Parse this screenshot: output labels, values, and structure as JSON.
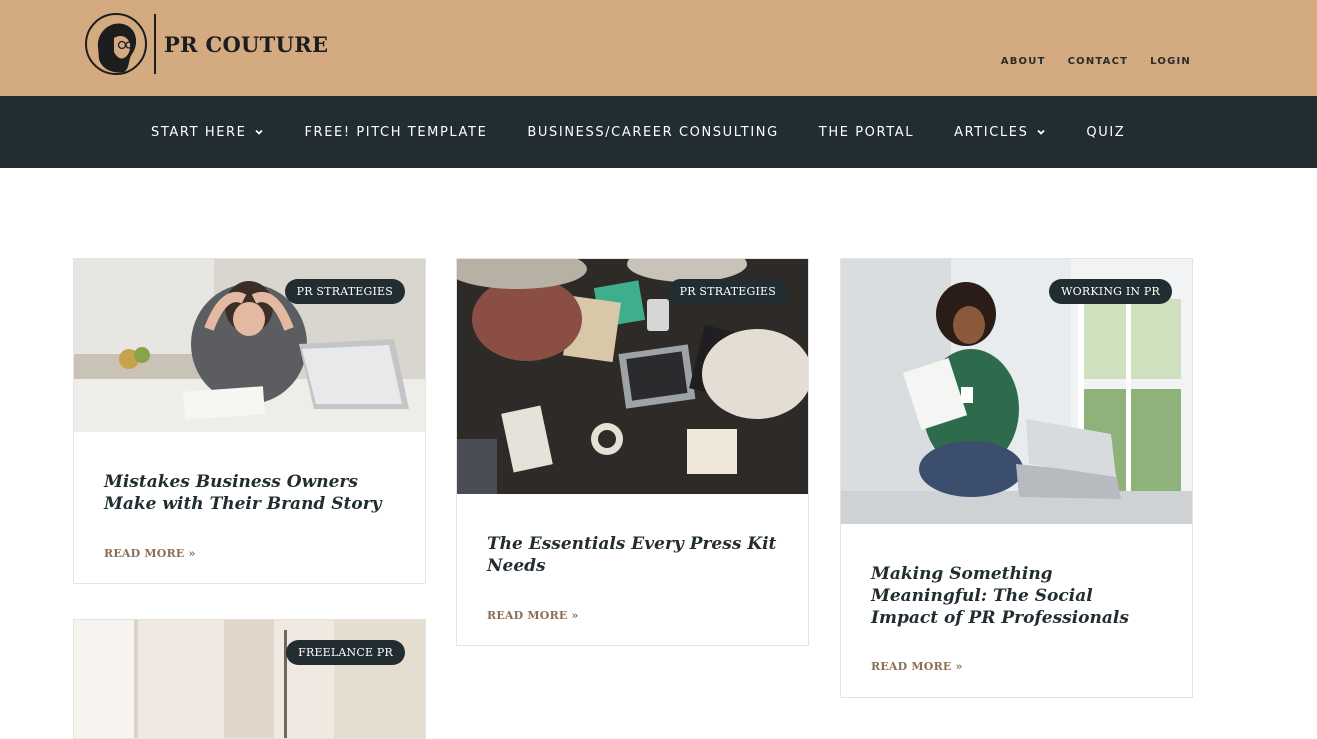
{
  "brand": {
    "name": "PR COUTURE"
  },
  "util_nav": [
    "ABOUT",
    "CONTACT",
    "LOGIN"
  ],
  "main_nav": [
    {
      "label": "START HERE",
      "dropdown": true
    },
    {
      "label": "FREE! PITCH TEMPLATE",
      "dropdown": false
    },
    {
      "label": "BUSINESS/CAREER CONSULTING",
      "dropdown": false
    },
    {
      "label": "THE PORTAL",
      "dropdown": false
    },
    {
      "label": "ARTICLES",
      "dropdown": true
    },
    {
      "label": "QUIZ",
      "dropdown": false
    }
  ],
  "colors": {
    "header_bg": "#d4aa80",
    "nav_bg": "#222d31",
    "badge_bg": "#222d31",
    "readmore": "#8a6f56"
  },
  "posts": [
    {
      "category": "PR STRATEGIES",
      "title": "Mistakes Business Owners Make with Their Brand Story",
      "read_more": "READ MORE »"
    },
    {
      "category": "PR STRATEGIES",
      "title": "The Essentials Every Press Kit Needs",
      "read_more": "READ MORE »"
    },
    {
      "category": "WORKING IN PR",
      "title": "Making Something Meaningful: The Social Impact of PR Professionals",
      "read_more": "READ MORE »"
    },
    {
      "category": "FREELANCE PR"
    }
  ]
}
